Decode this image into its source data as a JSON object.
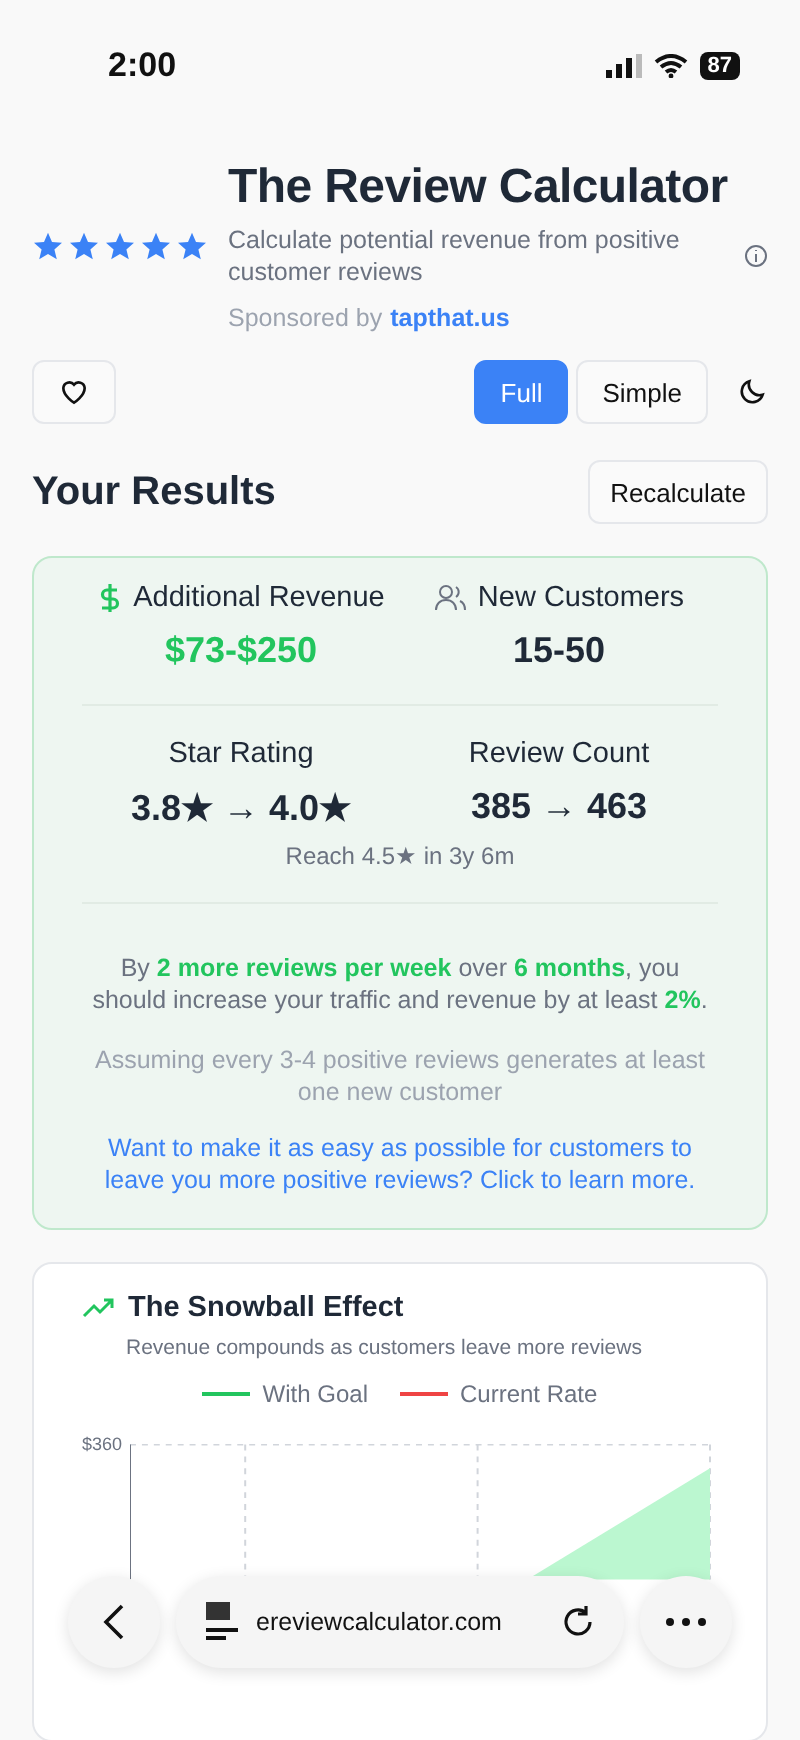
{
  "status_bar": {
    "time": "2:00",
    "battery": "87"
  },
  "header": {
    "title": "The Review Calculator",
    "stars": 5,
    "subtitle": "Calculate potential revenue from positive customer reviews",
    "sponsor_label": "Sponsored by",
    "sponsor_link": "tapthat.us"
  },
  "modes": [
    {
      "label": "Full",
      "selected": true
    },
    {
      "label": "Simple",
      "selected": false
    }
  ],
  "results": {
    "heading": "Your Results",
    "recalculate": "Recalculate",
    "metrics": [
      {
        "kind": "money",
        "label": "Additional Revenue",
        "value": "$73-$250"
      },
      {
        "kind": "people",
        "label": "New Customers",
        "value": "15-50"
      }
    ],
    "stats": [
      {
        "label": "Star Rating",
        "value": "3.8★ → 4.0★"
      },
      {
        "label": "Review Count",
        "value": "385 → 463"
      }
    ],
    "reach": "Reach 4.5★ in 3y 6m",
    "summary": "By **2 more reviews per week** over **6 months**, you should increase your traffic and revenue by at least **2%**.",
    "assumption": "Assuming every 3-4 positive reviews generates at least one new customer",
    "cta": "Want to make it as easy as possible for customers to leave you more positive reviews? Click to learn more."
  },
  "chart": {
    "title": "The Snowball Effect",
    "subtitle": "Revenue compounds as customers leave more reviews",
    "legend": [
      {
        "label": "With Goal",
        "color": "#22c55e"
      },
      {
        "label": "Current Rate",
        "color": "#ef4444"
      }
    ],
    "y_tick": "$360"
  },
  "browser": {
    "url": "ereviewcalculator.com"
  }
}
